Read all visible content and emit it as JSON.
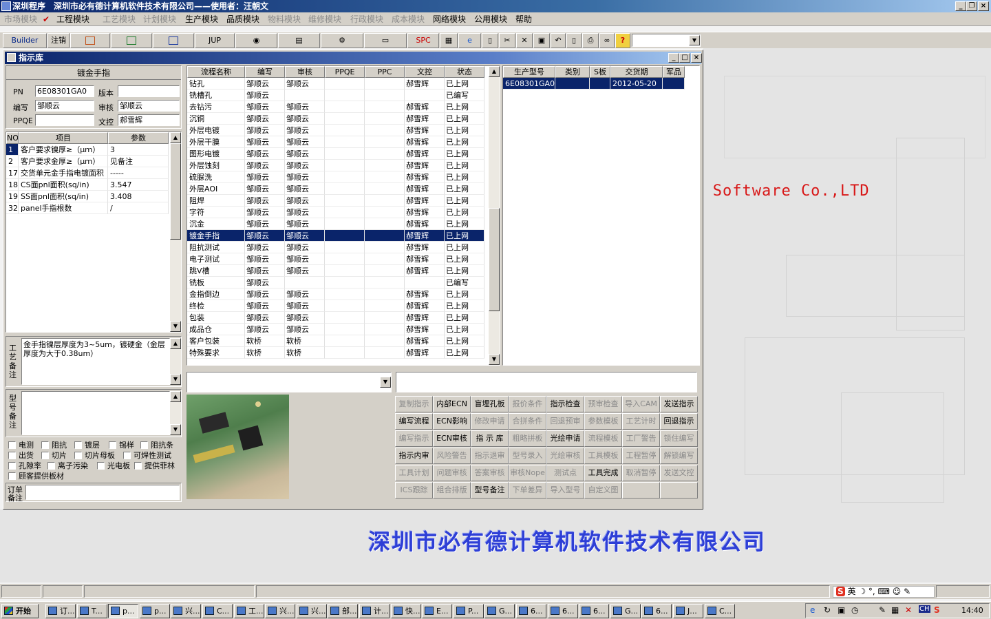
{
  "window": {
    "title": "深圳程序　深圳市必有德计算机软件技术有限公司——使用者：汪朝文"
  },
  "menu": [
    "市场模块",
    "工程模块",
    "工艺模块",
    "计划模块",
    "生产模块",
    "品质模块",
    "物料模块",
    "维修模块",
    "行政模块",
    "成本模块",
    "网络模块",
    "公用模块",
    "帮助"
  ],
  "toolbar": {
    "builder": "Builder",
    "logout": "注销",
    "jup": "JUP",
    "spc": "SPC"
  },
  "child": {
    "title": "指示库"
  },
  "info": {
    "header": "镀金手指",
    "pn_label": "PN",
    "pn": "6E08301GA0",
    "version_label": "版本",
    "version": "",
    "writer_label": "编写",
    "writer": "邹顺云",
    "reviewer_label": "审核",
    "reviewer": "邹顺云",
    "ppqe_label": "PPQE",
    "ppqe": "",
    "control_label": "文控",
    "control": "郝雪辉"
  },
  "params": {
    "headers": [
      "NO",
      "项目",
      "参数"
    ],
    "rows": [
      [
        "1",
        "客户要求镍厚≥（μｍ）",
        "3"
      ],
      [
        "2",
        "客户要求金厚≥（μｍ）",
        "见备注"
      ],
      [
        "17",
        "交货单元金手指电镀面积",
        "-----"
      ],
      [
        "18",
        "CS面pnl面积(sq/in)",
        "3.547"
      ],
      [
        "19",
        "SS面pnl面积(sq/in)",
        "3.408"
      ],
      [
        "32",
        "panel手指根数",
        "/"
      ]
    ]
  },
  "notes": {
    "process_label": "工艺备注",
    "process_text": "金手指镍层厚度为3~5um，镀硬金（金层厚度为大于0.38um）",
    "model_label": "型号备注",
    "order_label": "订单备注"
  },
  "checkboxes": [
    [
      "电测",
      "阻抗",
      "镀层",
      "锡样",
      "阻抗条"
    ],
    [
      "出货",
      "切片",
      "切片母板",
      "可焊性测试"
    ],
    [
      "孔隙率",
      "离子污染",
      "光电板",
      "提供菲林"
    ],
    [
      "顾客提供板材"
    ]
  ],
  "flow": {
    "headers": [
      "流程名称",
      "编写",
      "审核",
      "PPQE",
      "PPC",
      "文控",
      "状态"
    ],
    "selected_index": 13,
    "rows": [
      [
        "钻孔",
        "邹顺云",
        "邹顺云",
        "",
        "",
        "郝雪辉",
        "已上网"
      ],
      [
        "铣槽孔",
        "邹顺云",
        "",
        "",
        "",
        "",
        "已编写"
      ],
      [
        "去钻污",
        "邹顺云",
        "邹顺云",
        "",
        "",
        "郝雪辉",
        "已上网"
      ],
      [
        "沉铜",
        "邹顺云",
        "邹顺云",
        "",
        "",
        "郝雪辉",
        "已上网"
      ],
      [
        "外层电镀",
        "邹顺云",
        "邹顺云",
        "",
        "",
        "郝雪辉",
        "已上网"
      ],
      [
        "外层干膜",
        "邹顺云",
        "邹顺云",
        "",
        "",
        "郝雪辉",
        "已上网"
      ],
      [
        "图形电镀",
        "邹顺云",
        "邹顺云",
        "",
        "",
        "郝雪辉",
        "已上网"
      ],
      [
        "外层蚀刻",
        "邹顺云",
        "邹顺云",
        "",
        "",
        "郝雪辉",
        "已上网"
      ],
      [
        "硫脲洗",
        "邹顺云",
        "邹顺云",
        "",
        "",
        "郝雪辉",
        "已上网"
      ],
      [
        "外层AOI",
        "邹顺云",
        "邹顺云",
        "",
        "",
        "郝雪辉",
        "已上网"
      ],
      [
        "阻焊",
        "邹顺云",
        "邹顺云",
        "",
        "",
        "郝雪辉",
        "已上网"
      ],
      [
        "字符",
        "邹顺云",
        "邹顺云",
        "",
        "",
        "郝雪辉",
        "已上网"
      ],
      [
        "沉金",
        "邹顺云",
        "邹顺云",
        "",
        "",
        "郝雪辉",
        "已上网"
      ],
      [
        "镀金手指",
        "邹顺云",
        "邹顺云",
        "",
        "",
        "郝雪辉",
        "已上网"
      ],
      [
        "阻抗测试",
        "邹顺云",
        "邹顺云",
        "",
        "",
        "郝雪辉",
        "已上网"
      ],
      [
        "电子测试",
        "邹顺云",
        "邹顺云",
        "",
        "",
        "郝雪辉",
        "已上网"
      ],
      [
        "跳V槽",
        "邹顺云",
        "邹顺云",
        "",
        "",
        "郝雪辉",
        "已上网"
      ],
      [
        "铣板",
        "邹顺云",
        "",
        "",
        "",
        "",
        "已编写"
      ],
      [
        "金指倒边",
        "邹顺云",
        "邹顺云",
        "",
        "",
        "郝雪辉",
        "已上网"
      ],
      [
        "终检",
        "邹顺云",
        "邹顺云",
        "",
        "",
        "郝雪辉",
        "已上网"
      ],
      [
        "包装",
        "邹顺云",
        "邹顺云",
        "",
        "",
        "郝雪辉",
        "已上网"
      ],
      [
        "成品仓",
        "邹顺云",
        "邹顺云",
        "",
        "",
        "郝雪辉",
        "已上网"
      ],
      [
        "客户包装",
        "软桥",
        "软桥",
        "",
        "",
        "郝雪辉",
        "已上网"
      ],
      [
        "特殊要求",
        "软桥",
        "软桥",
        "",
        "",
        "郝雪辉",
        "已上网"
      ]
    ]
  },
  "models": {
    "headers": [
      "生产型号",
      "类别",
      "S板",
      "交货期",
      "军品"
    ],
    "rows": [
      [
        "6E08301GA0",
        "",
        "",
        "2012-05-20",
        ""
      ]
    ]
  },
  "actions": [
    [
      [
        "复制指示",
        false
      ],
      [
        "内部ECN",
        true
      ],
      [
        "盲埋孔板",
        true
      ],
      [
        "报价条件",
        false
      ],
      [
        "指示检查",
        true
      ],
      [
        "预审检查",
        false
      ],
      [
        "导入CAM",
        false
      ],
      [
        "发送指示",
        true
      ]
    ],
    [
      [
        "编写流程",
        true
      ],
      [
        "ECN影响",
        true
      ],
      [
        "修改申请",
        false
      ],
      [
        "合拼条件",
        false
      ],
      [
        "回退预审",
        false
      ],
      [
        "参数模板",
        false
      ],
      [
        "工艺计时",
        false
      ],
      [
        "回退指示",
        true
      ]
    ],
    [
      [
        "编写指示",
        false
      ],
      [
        "ECN审核",
        true
      ],
      [
        "指 示 库",
        true
      ],
      [
        "粗略拼板",
        false
      ],
      [
        "光绘申请",
        true
      ],
      [
        "流程模板",
        false
      ],
      [
        "工厂警告",
        false
      ],
      [
        "锁住编写",
        false
      ]
    ],
    [
      [
        "指示内审",
        true
      ],
      [
        "风险警告",
        false
      ],
      [
        "指示退审",
        false
      ],
      [
        "型号录入",
        false
      ],
      [
        "光绘审核",
        false
      ],
      [
        "工具模板",
        false
      ],
      [
        "工程暂停",
        false
      ],
      [
        "解锁编写",
        false
      ]
    ],
    [
      [
        "工具计划",
        false
      ],
      [
        "问题审核",
        false
      ],
      [
        "答案审核",
        false
      ],
      [
        "审核Nope",
        false
      ],
      [
        "测试点",
        false
      ],
      [
        "工具完成",
        true
      ],
      [
        "取消暂停",
        false
      ],
      [
        "发送文控",
        false
      ]
    ],
    [
      [
        "ICS跟踪",
        false
      ],
      [
        "组合排版",
        false
      ],
      [
        "型号备注",
        true
      ],
      [
        "下单差异",
        false
      ],
      [
        "导入型号",
        false
      ],
      [
        "自定义图",
        false
      ],
      [
        "",
        false
      ],
      [
        "",
        false
      ]
    ]
  ],
  "banner": {
    "text": "er Software Co.,LTD",
    "company": "深圳市必有德计算机软件技术有限公司"
  },
  "taskbar": {
    "start": "开始",
    "items": [
      "订...",
      "T...",
      "p...",
      "p...",
      "兴...",
      "C...",
      "工...",
      "兴...",
      "兴...",
      "部...",
      "计...",
      "快...",
      "E...",
      "P...",
      "G...",
      "6...",
      "6...",
      "6...",
      "G...",
      "6...",
      "J...",
      "C..."
    ],
    "clock": "14:40",
    "ime": "英"
  }
}
